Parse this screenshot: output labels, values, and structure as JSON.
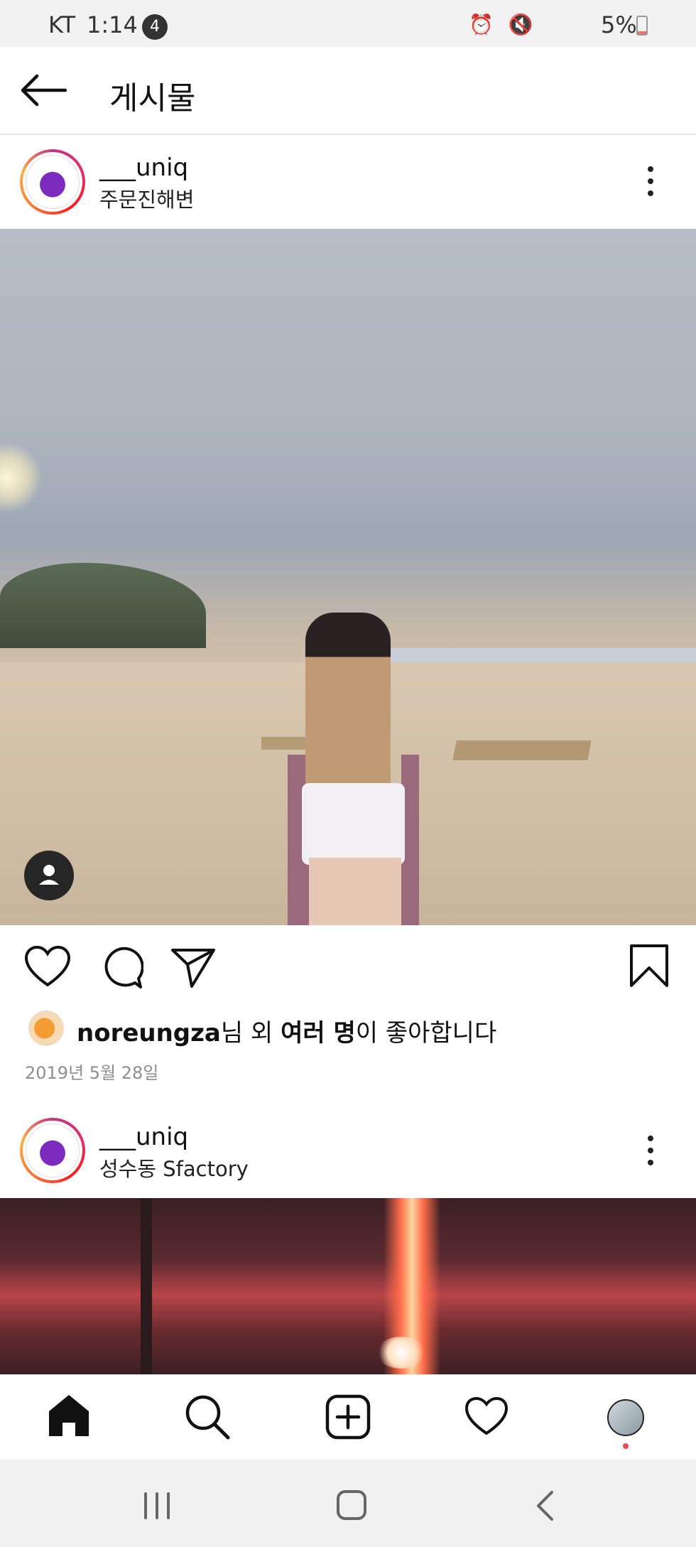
{
  "status_bar": {
    "carrier": "KT",
    "time": "1:14",
    "notification_count": "4",
    "battery": "5%"
  },
  "header": {
    "title": "게시물"
  },
  "posts": [
    {
      "username": "___uniq",
      "location": "주문진해변"
    },
    {
      "username": "___uniq",
      "location": "성수동 Sfactory"
    }
  ],
  "likes": {
    "user": "noreungza",
    "suffix1": "님 외 ",
    "bold2": "여러 명",
    "suffix2": "이 좋아합니다"
  },
  "date": "2019년 5월 28일",
  "bottom_nav": [
    "home-icon",
    "search-icon",
    "add-icon",
    "heart-icon",
    "profile-avatar"
  ],
  "colors": {
    "notification_dot": "#ed4956",
    "avatar_ring": "#e1306c"
  }
}
